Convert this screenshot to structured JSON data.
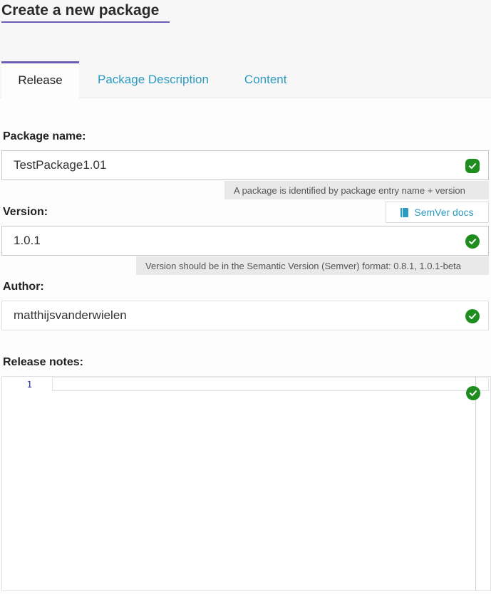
{
  "page": {
    "title": "Create a new package"
  },
  "tabs": [
    {
      "label": "Release",
      "active": true
    },
    {
      "label": "Package Description",
      "active": false
    },
    {
      "label": "Content",
      "active": false
    }
  ],
  "form": {
    "package_name": {
      "label": "Package name:",
      "value": "TestPackage1.01",
      "hint": "A package is identified by package entry name + version"
    },
    "version": {
      "label": "Version:",
      "value": "1.0.1",
      "hint": "Version should be in the Semantic Version (Semver) format: 0.8.1, 1.0.1-beta",
      "docs_label": "SemVer docs"
    },
    "author": {
      "label": "Author:",
      "value": "matthijsvanderwielen"
    },
    "release_notes": {
      "label": "Release notes:",
      "line_number": "1"
    }
  },
  "icons": {
    "valid": "check-circle-icon",
    "docs": "book-icon"
  },
  "colors": {
    "accent": "#6f5cb8",
    "link": "#2b9bc2",
    "valid": "#1e8d1e"
  }
}
